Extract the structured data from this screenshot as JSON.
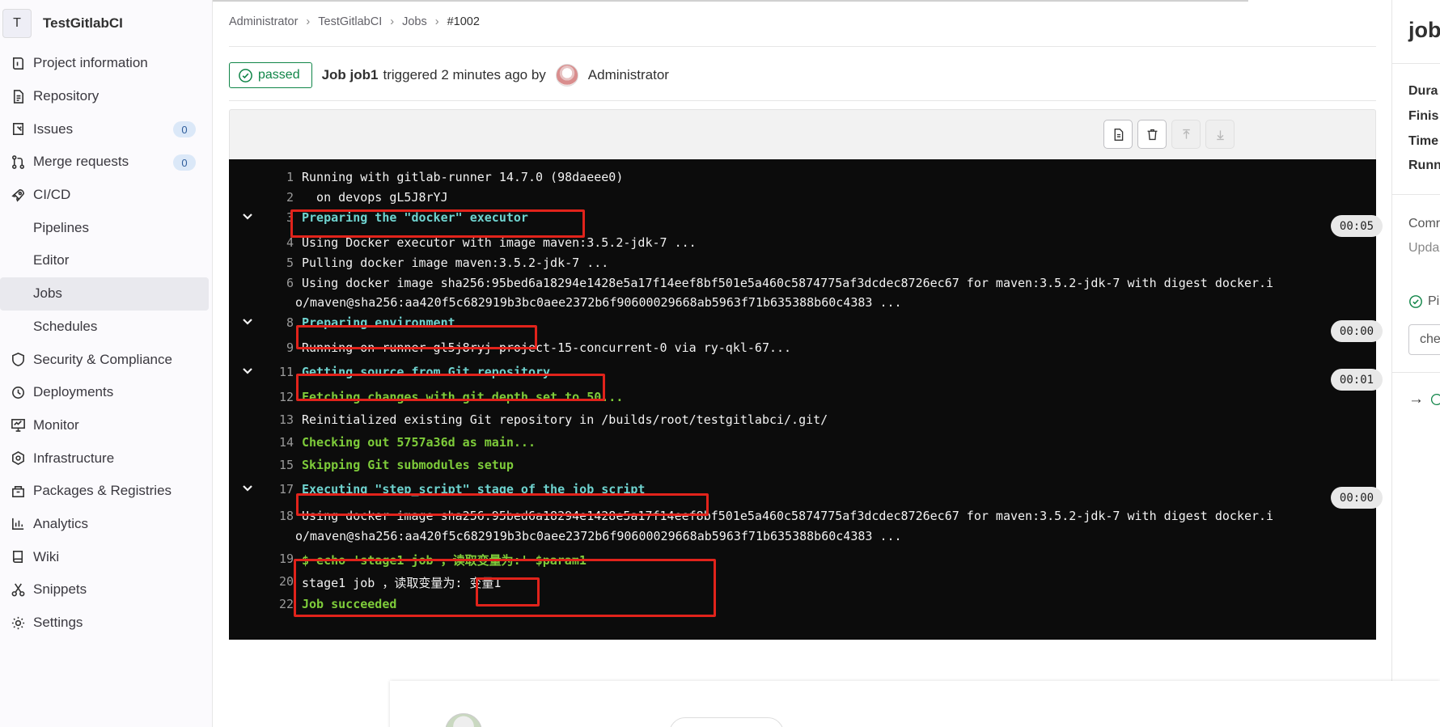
{
  "project": {
    "initial": "T",
    "name": "TestGitlabCI"
  },
  "sidebar": {
    "items": [
      {
        "label": "Project information",
        "icon": "info-book-icon"
      },
      {
        "label": "Repository",
        "icon": "document-icon"
      },
      {
        "label": "Issues",
        "icon": "issues-icon",
        "badge": "0"
      },
      {
        "label": "Merge requests",
        "icon": "merge-request-icon",
        "badge": "0"
      },
      {
        "label": "CI/CD",
        "icon": "rocket-icon"
      },
      {
        "label": "Pipelines"
      },
      {
        "label": "Editor"
      },
      {
        "label": "Jobs"
      },
      {
        "label": "Schedules"
      },
      {
        "label": "Security & Compliance",
        "icon": "shield-icon"
      },
      {
        "label": "Deployments",
        "icon": "deployments-icon"
      },
      {
        "label": "Monitor",
        "icon": "monitor-icon"
      },
      {
        "label": "Infrastructure",
        "icon": "infrastructure-icon"
      },
      {
        "label": "Packages & Registries",
        "icon": "package-icon"
      },
      {
        "label": "Analytics",
        "icon": "chart-icon"
      },
      {
        "label": "Wiki",
        "icon": "book-icon"
      },
      {
        "label": "Snippets",
        "icon": "scissors-icon"
      },
      {
        "label": "Settings",
        "icon": "gear-icon"
      }
    ]
  },
  "breadcrumb": [
    "Administrator",
    "TestGitlabCI",
    "Jobs",
    "#1002"
  ],
  "job": {
    "status": "passed",
    "title": "Job job1",
    "triggered": "triggered 2 minutes ago by",
    "user": "Administrator"
  },
  "log": {
    "lines": [
      {
        "n": "1",
        "text": "Running with gitlab-runner 14.7.0 (98daeee0)"
      },
      {
        "n": "2",
        "text": "  on devops gL5J8rYJ"
      },
      {
        "n": "3",
        "text": "Preparing the \"docker\" executor",
        "duration": "00:05"
      },
      {
        "n": "4",
        "text": "Using Docker executor with image maven:3.5.2-jdk-7 ..."
      },
      {
        "n": "5",
        "text": "Pulling docker image maven:3.5.2-jdk-7 ..."
      },
      {
        "n": "6",
        "text": "Using docker image sha256:95bed6a18294e1428e5a17f14eef8bf501e5a460c5874775af3dcdec8726ec67 for maven:3.5.2-jdk-7 with digest docker.i",
        "text2": "o/maven@sha256:aa420f5c682919b3bc0aee2372b6f90600029668ab5963f71b635388b60c4383 ..."
      },
      {
        "n": "8",
        "text": "Preparing environment",
        "duration": "00:00"
      },
      {
        "n": "9",
        "text": "Running on runner-gl5j8ryj-project-15-concurrent-0 via ry-qkl-67..."
      },
      {
        "n": "11",
        "text": "Getting source from Git repository",
        "duration": "00:01"
      },
      {
        "n": "12",
        "text": "Fetching changes with git depth set to 50..."
      },
      {
        "n": "13",
        "text": "Reinitialized existing Git repository in /builds/root/testgitlabci/.git/"
      },
      {
        "n": "14",
        "text": "Checking out 5757a36d as main..."
      },
      {
        "n": "15",
        "text": "Skipping Git submodules setup"
      },
      {
        "n": "17",
        "text": "Executing \"step_script\" stage of the job script",
        "duration": "00:00"
      },
      {
        "n": "18",
        "text": "Using docker image sha256:95bed6a18294e1428e5a17f14eef8bf501e5a460c5874775af3dcdec8726ec67 for maven:3.5.2-jdk-7 with digest docker.i",
        "text2": "o/maven@sha256:aa420f5c682919b3bc0aee2372b6f90600029668ab5963f71b635388b60c4383 ..."
      },
      {
        "n": "19",
        "text": "$ echo 'stage1 job ，读取变量为:' $param1"
      },
      {
        "n": "20",
        "text": "stage1 job ，读取变量为: 变量1"
      },
      {
        "n": "22",
        "text": "Job succeeded"
      }
    ]
  },
  "right_panel": {
    "title": "job",
    "rows": [
      "Dura",
      "Finis",
      "Time",
      "Runn"
    ],
    "commit_label": "Comr",
    "commit_sub": "Upda",
    "pipeline_label": "Pi",
    "stage_select": "che",
    "arrow": "→"
  },
  "colors": {
    "passed": "#108548",
    "highlight": "#e1231b",
    "log_bg": "#0c0c0c",
    "section": "#6fd3cf",
    "git": "#7ecc3a"
  }
}
